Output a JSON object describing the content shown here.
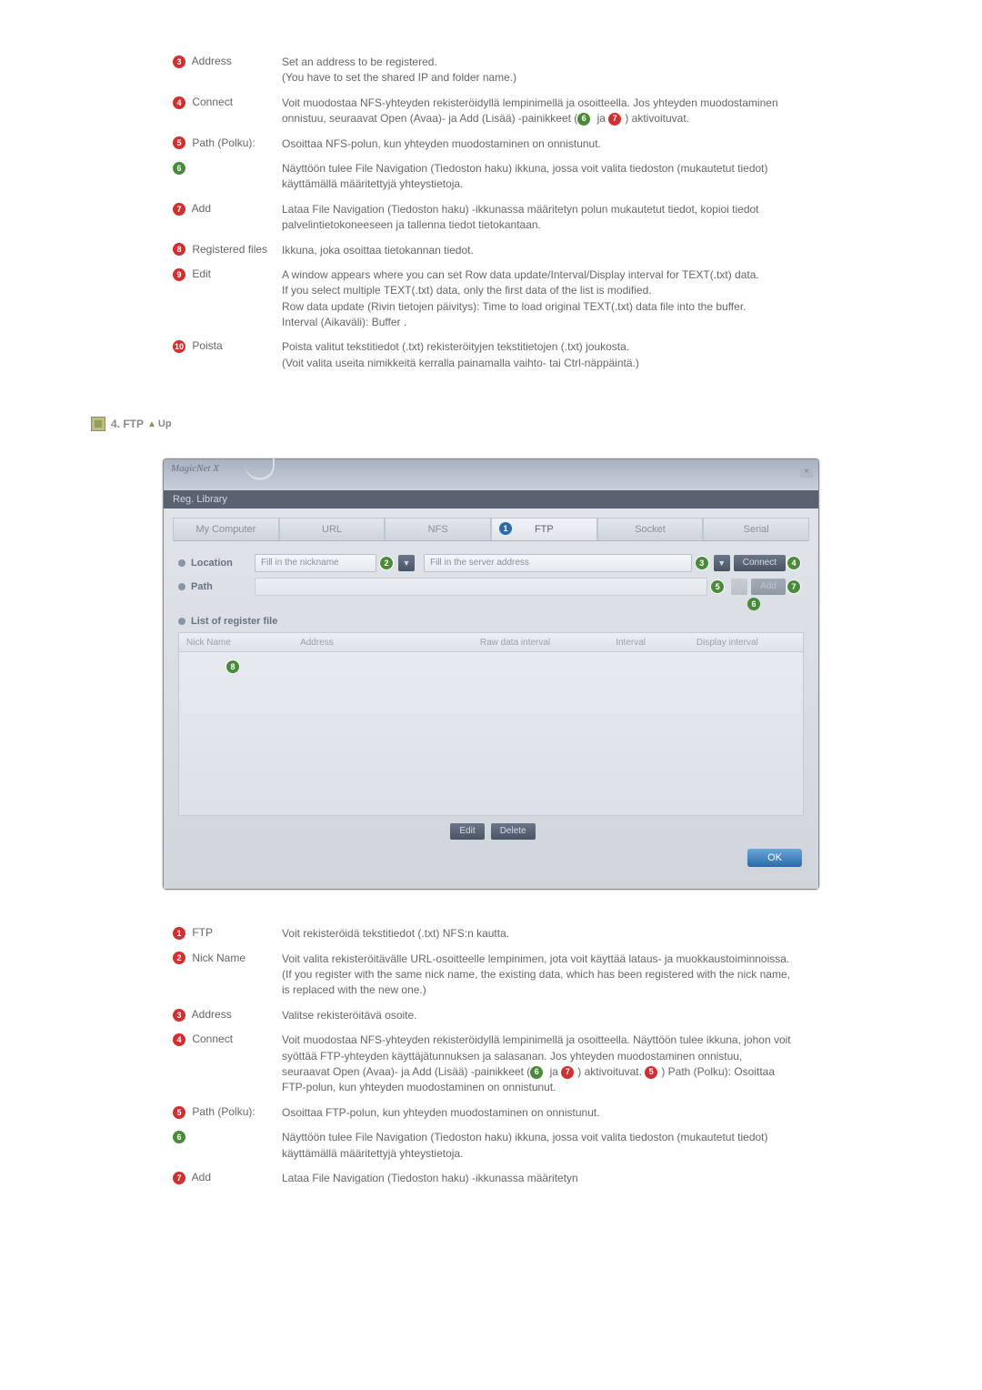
{
  "upper": [
    {
      "badge": {
        "n": "3",
        "color": "nb-red"
      },
      "label": "Address",
      "desc": "Set an address to be registered.\n(You have to set the shared IP and folder name.)"
    },
    {
      "badge": {
        "n": "4",
        "color": "nb-red"
      },
      "label": "Connect",
      "desc": "Voit muodostaa NFS-yhteyden rekisteröidyllä lempinimellä ja osoitteella. Jos yhteyden muodostaminen onnistuu, seuraavat Open (Avaa)- ja Add (Lisää) -painikkeet ({6} ja {7}) aktivoituvat."
    },
    {
      "badge": {
        "n": "5",
        "color": "nb-red"
      },
      "label": "Path (Polku):",
      "desc": "Osoittaa NFS-polun, kun yhteyden muodostaminen on onnistunut."
    },
    {
      "badge": {
        "n": "6",
        "color": "nb-green"
      },
      "label": "",
      "desc": "Näyttöön tulee File Navigation (Tiedoston haku) ikkuna, jossa voit valita tiedoston (mukautetut tiedot) käyttämällä määritettyjä yhteystietoja."
    },
    {
      "badge": {
        "n": "7",
        "color": "nb-red"
      },
      "label": "Add",
      "desc": "Lataa File Navigation (Tiedoston haku) -ikkunassa määritetyn polun mukautetut tiedot, kopioi tiedot palvelintietokoneeseen ja tallenna tiedot tietokantaan."
    },
    {
      "badge": {
        "n": "8",
        "color": "nb-red"
      },
      "label": "Registered files",
      "desc": "Ikkuna, joka osoittaa tietokannan tiedot."
    },
    {
      "badge": {
        "n": "9",
        "color": "nb-red"
      },
      "label": "Edit",
      "desc": "A window appears where you can set Row data update/Interval/Display interval for TEXT(.txt) data.\nIf you select multiple TEXT(.txt) data, only the first data of the list is modified.\nRow data update (Rivin tietojen päivitys): Time to load original TEXT(.txt) data file into the buffer.\nInterval (Aikaväli): Buffer ."
    },
    {
      "badge": {
        "n": "10",
        "color": "nb-red"
      },
      "label": "Poista",
      "desc": "Poista valitut tekstitiedot (.txt) rekisteröityjen tekstitietojen (.txt) joukosta.\n(Voit valita useita nimikkeitä kerralla painamalla vaihto- tai Ctrl-näppäintä.)"
    }
  ],
  "section4": {
    "title": "4. FTP",
    "up": "Up"
  },
  "app": {
    "title": "MagicNet X",
    "menu": "Reg. Library",
    "tabs": [
      "My Computer",
      "URL",
      "NFS",
      "FTP",
      "Socket",
      "Serial"
    ],
    "activeTabIndex": 3,
    "locationLabel": "Location",
    "locationPlaceholder": "Fill in the nickname",
    "addressPlaceholder": "Fill in the server address",
    "pathLabel": "Path",
    "connectBtn": "Connect",
    "addBtn": "Add",
    "listLabel": "List of register file",
    "columns": [
      "Nick Name",
      "Address",
      "Raw data interval",
      "Interval",
      "Display interval"
    ],
    "editBtn": "Edit",
    "deleteBtn": "Delete",
    "okBtn": "OK"
  },
  "lower": [
    {
      "badge": {
        "n": "1",
        "color": "nb-red"
      },
      "label": "FTP",
      "desc": "Voit rekisteröidä tekstitiedot (.txt) NFS:n kautta."
    },
    {
      "badge": {
        "n": "2",
        "color": "nb-red"
      },
      "label": "Nick Name",
      "desc": "Voit valita rekisteröitävälle URL-osoitteelle lempinimen, jota voit käyttää lataus- ja muokkaustoiminnoissa. (If you register with the same nick name, the existing data, which has been registered with the nick name, is replaced with the new one.)"
    },
    {
      "badge": {
        "n": "3",
        "color": "nb-red"
      },
      "label": "Address",
      "desc": "Valitse rekisteröitävä osoite."
    },
    {
      "badge": {
        "n": "4",
        "color": "nb-red"
      },
      "label": "Connect",
      "desc": "Voit muodostaa NFS-yhteyden rekisteröidyllä lempinimellä ja osoitteella. Näyttöön tulee ikkuna, johon voit syöttää FTP-yhteyden käyttäjätunnuksen ja salasanan. Jos yhteyden muodostaminen onnistuu, seuraavat Open (Avaa)- ja Add (Lisää) -painikkeet ({6} ja {7}) aktivoituvat. {5}) Path (Polku): Osoittaa FTP-polun, kun yhteyden muodostaminen on onnistunut."
    },
    {
      "badge": {
        "n": "5",
        "color": "nb-red"
      },
      "label": "Path (Polku):",
      "desc": "Osoittaa FTP-polun, kun yhteyden muodostaminen on onnistunut."
    },
    {
      "badge": {
        "n": "6",
        "color": "nb-green"
      },
      "label": "",
      "desc": "Näyttöön tulee File Navigation (Tiedoston haku) ikkuna, jossa voit valita tiedoston (mukautetut tiedot) käyttämällä määritettyjä yhteystietoja."
    },
    {
      "badge": {
        "n": "7",
        "color": "nb-red"
      },
      "label": "Add",
      "desc": "Lataa File Navigation (Tiedoston haku) -ikkunassa määritetyn"
    }
  ],
  "inlineBadges": {
    "5": {
      "n": "5",
      "color": "nb-red"
    },
    "6": {
      "n": "6",
      "color": "nb-green"
    },
    "7": {
      "n": "7",
      "color": "nb-red"
    }
  }
}
